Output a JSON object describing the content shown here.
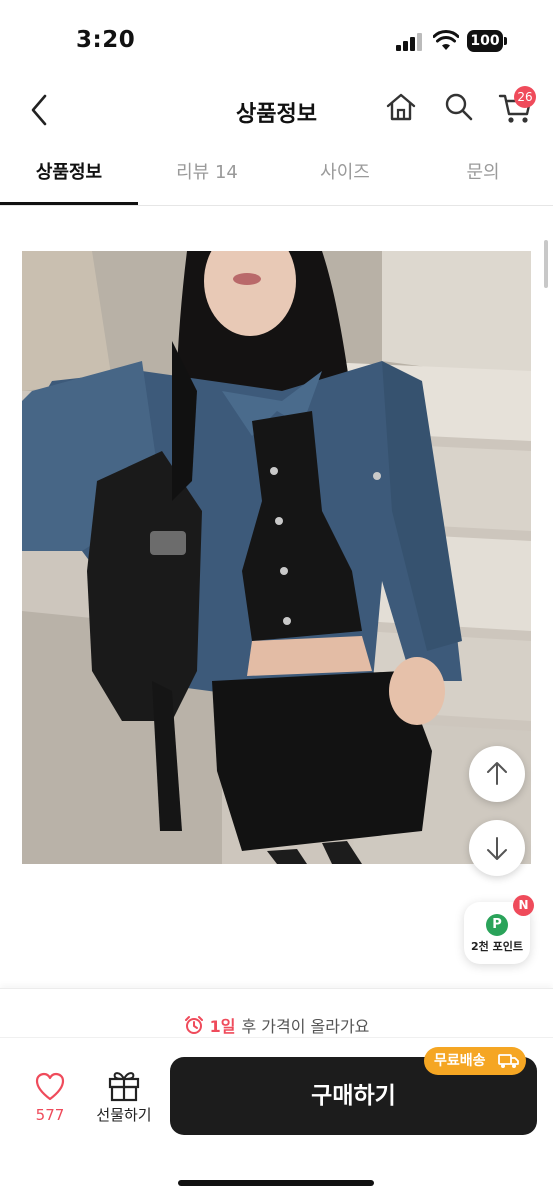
{
  "status_bar": {
    "time": "3:20",
    "battery": "100"
  },
  "header": {
    "title": "상품정보",
    "cart_count": "26"
  },
  "tabs": [
    {
      "label": "상품정보",
      "active": true
    },
    {
      "label": "리뷰 14",
      "active": false
    },
    {
      "label": "사이즈",
      "active": false
    },
    {
      "label": "문의",
      "active": false
    }
  ],
  "floating": {
    "points_label": "2천 포인트",
    "points_icon": "P",
    "new_badge": "N"
  },
  "bottom": {
    "notice_day": "1일",
    "notice_text": "후 가격이 올라가요",
    "like_count": "577",
    "gift_label": "선물하기",
    "buy_label": "구매하기",
    "shipping_badge": "무료배송"
  },
  "colors": {
    "accent": "#ef4b5b",
    "shipping": "#f5a623",
    "buy": "#1c1c1c",
    "points": "#2aa35a"
  }
}
